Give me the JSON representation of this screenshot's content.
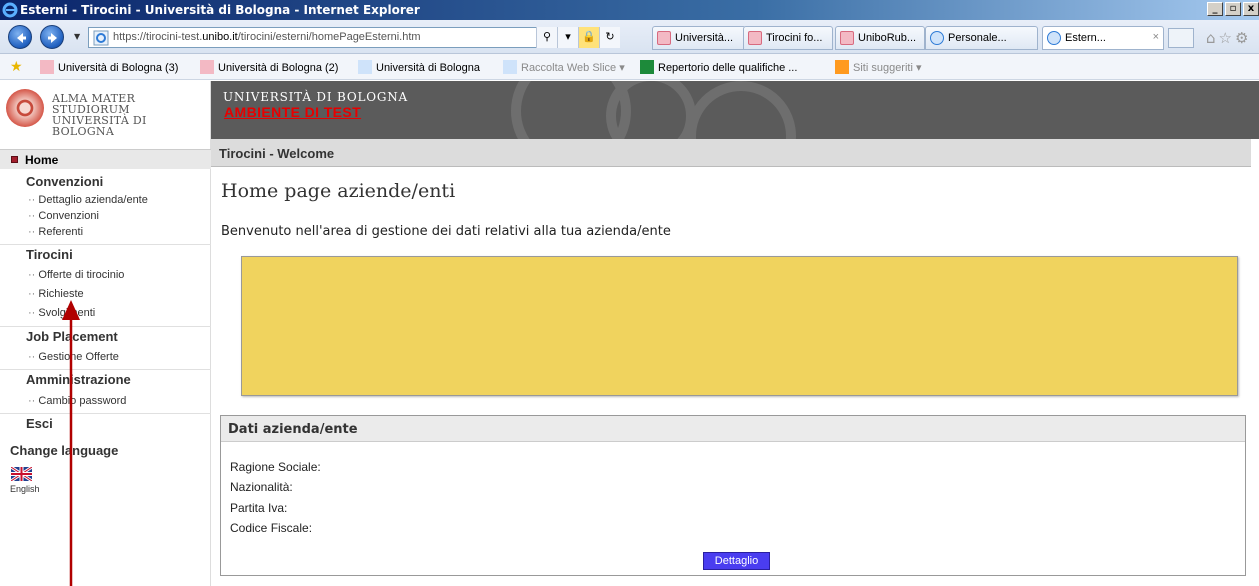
{
  "window": {
    "title": "Esterni - Tirocini - Università di Bologna - Internet Explorer",
    "controls": [
      "_",
      "▫",
      "x"
    ]
  },
  "browser": {
    "address": {
      "url_prefix": "https://tirocini-test.",
      "url_domain": "unibo.it",
      "url_suffix": "/tirocini/esterni/homePageEsterni.htm"
    },
    "tabs": [
      {
        "label": "Università...",
        "icon": "unibo-favicon"
      },
      {
        "label": "Tirocini fo...",
        "icon": "unibo-favicon"
      },
      {
        "label": "UniboRub...",
        "icon": "unibo-favicon"
      },
      {
        "label": "Personale...",
        "icon": "ie-page-icon"
      },
      {
        "label": "Estern...",
        "icon": "ie-page-icon",
        "active": true
      }
    ],
    "favorites": [
      {
        "label": "Università di Bologna (3)",
        "icon": "unibo-favicon"
      },
      {
        "label": "Università di Bologna (2)",
        "icon": "unibo-favicon"
      },
      {
        "label": "Università di Bologna",
        "icon": "ie-page-icon"
      },
      {
        "label": "Raccolta Web Slice ▾",
        "icon": "ie-page-icon"
      },
      {
        "label": "Repertorio delle qualifiche ...",
        "icon": "flag-icon"
      },
      {
        "label": "Siti suggeriti ▾",
        "icon": "suggested-sites-icon"
      }
    ]
  },
  "header": {
    "alma_line1": "ALMA MATER STUDIORUM",
    "alma_line2": "UNIVERSITÀ DI BOLOGNA",
    "university": "UNIVERSITÀ DI BOLOGNA",
    "environment": "AMBIENTE DI TEST"
  },
  "nav": {
    "home": "Home",
    "sections": [
      {
        "title": "Convenzioni",
        "items": [
          "Dettaglio azienda/ente",
          "Convenzioni",
          "Referenti"
        ]
      },
      {
        "title": "Tirocini",
        "items": [
          "Offerte di tirocinio",
          "Richieste",
          "Svolgimenti"
        ]
      },
      {
        "title": "Job Placement",
        "items": [
          "Gestione Offerte"
        ]
      },
      {
        "title": "Amministrazione",
        "items": [
          "Cambio password"
        ]
      },
      {
        "title": "Esci",
        "items": []
      }
    ],
    "change_language": "Change language",
    "language": "English"
  },
  "main": {
    "breadcrumb": "Tirocini - Welcome",
    "title": "Home page aziende/enti",
    "welcome": "Benvenuto nell'area di gestione dei dati relativi alla tua azienda/ente",
    "dati": {
      "heading": "Dati azienda/ente",
      "fields": [
        "Ragione Sociale:",
        "Nazionalità:",
        "Partita Iva:",
        "Codice Fiscale:"
      ],
      "button": "Dettaglio"
    }
  },
  "colors": {
    "notice_box": "#f0d35e",
    "environment_text": "#e60000",
    "button": "#4a3df0",
    "annotation_arrow": "#b00000"
  }
}
